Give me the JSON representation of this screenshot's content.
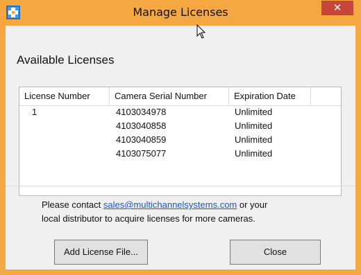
{
  "window": {
    "title": "Manage Licenses",
    "close_glyph": "✕",
    "title_bar_color": "#f5a841",
    "close_button_color": "#c7463a"
  },
  "main": {
    "section_title": "Available Licenses",
    "table": {
      "columns": [
        "License Number",
        "Camera Serial Number",
        "Expiration Date"
      ],
      "rows": [
        {
          "license": "1",
          "serial": "4103034978",
          "expiration": "Unlimited"
        },
        {
          "license": "",
          "serial": "4103040858",
          "expiration": "Unlimited"
        },
        {
          "license": "",
          "serial": "4103040859",
          "expiration": "Unlimited"
        },
        {
          "license": "",
          "serial": "4103075077",
          "expiration": "Unlimited"
        }
      ]
    },
    "info": {
      "prefix": "Please contact ",
      "email": "sales@multichannelsystems.com",
      "suffix_line1": " or your",
      "line2": "local distributor to acquire licenses for more cameras."
    }
  },
  "buttons": {
    "add_license": "Add License File...",
    "close": "Close"
  },
  "icons": {
    "app": "app-logo-icon",
    "cursor": "mouse-cursor-icon",
    "close": "close-icon"
  }
}
